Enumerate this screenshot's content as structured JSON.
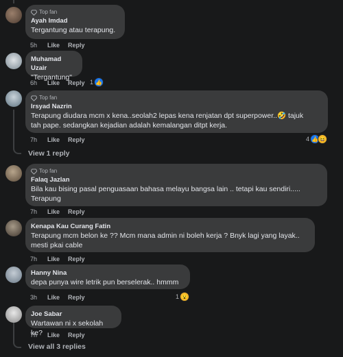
{
  "comments": [
    {
      "badge": "Top fan",
      "name": "Ayah Imdad",
      "text": "Tergantung atau terapung.",
      "time": "5h",
      "like": "Like",
      "reply": "Reply"
    },
    {
      "badge": "",
      "name": "Muhamad Uzair",
      "text": "\"Tergantung\"",
      "time": "6h",
      "like": "Like",
      "reply": "Reply",
      "reaction_count": "1"
    },
    {
      "badge": "Top fan",
      "name": "Irsyad Nazrin",
      "text": "Terapung diudara mcm x kena..seolah2 lepas kena renjatan dpt superpower..🤣 tajuk\ntah pape. sedangkan kejadian adalah kemalangan ditpt kerja.",
      "time": "7h",
      "like": "Like",
      "reply": "Reply",
      "reaction_count": "4"
    },
    {
      "badge": "Top fan",
      "name": "Falaq Jazlan",
      "text": "Bila kau bising pasal penguasaan bahasa melayu bangsa lain .. tetapi kau sendiri.....\nTerapung",
      "time": "7h",
      "like": "Like",
      "reply": "Reply"
    },
    {
      "badge": "",
      "name": "Kenapa Kau Curang Fatin",
      "text": "Terapung mcm belon ke ?? Mcm mana admin ni boleh kerja ? Bnyk lagi yang layak..\nmesti pkai cable",
      "time": "7h",
      "like": "Like",
      "reply": "Reply"
    },
    {
      "badge": "",
      "name": "Hanny Nina",
      "text": "depa punya wire letrik pun berselerak.. hmmm",
      "time": "3h",
      "like": "Like",
      "reply": "Reply",
      "reaction_count": "1"
    },
    {
      "badge": "",
      "name": "Joe Sabar",
      "text": "Wartawan ni x sekolah ke?",
      "time": "7h",
      "like": "Like",
      "reply": "Reply"
    }
  ],
  "view_reply": "View 1 reply",
  "view_all": "View all 3 replies",
  "colors": {
    "like": "#1877f2",
    "haha": "#f7b928",
    "bubble": "#3a3b3c",
    "bg": "#18191a"
  }
}
